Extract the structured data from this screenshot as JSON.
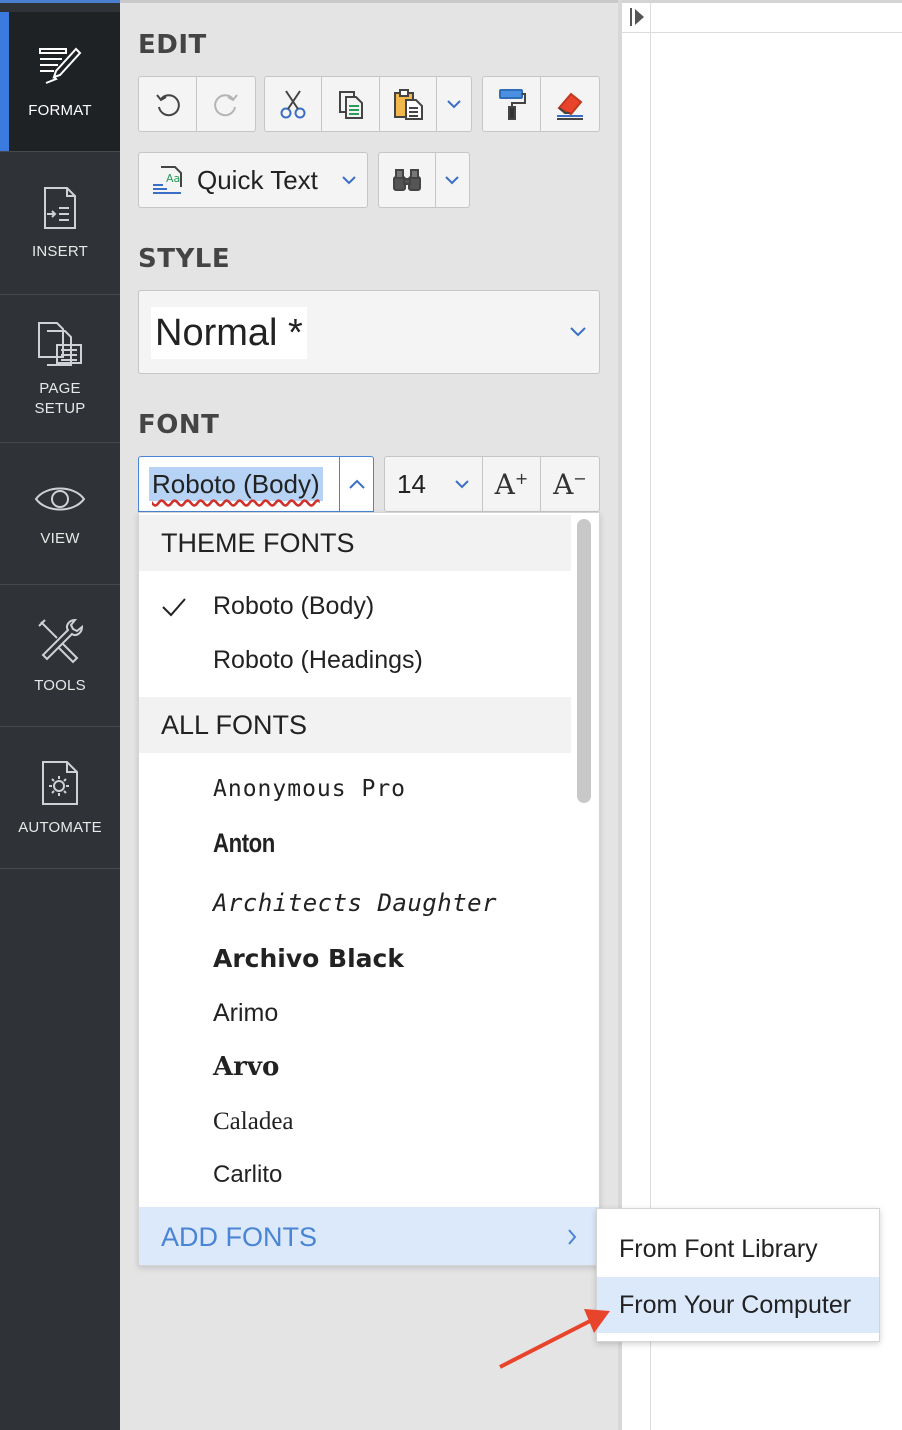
{
  "nav_rail": {
    "items": [
      {
        "label": "FORMAT",
        "icon": "format-brush-icon",
        "active": true
      },
      {
        "label": "INSERT",
        "icon": "insert-icon",
        "active": false
      },
      {
        "label": "PAGE\nSETUP",
        "icon": "page-setup-icon",
        "active": false
      },
      {
        "label": "VIEW",
        "icon": "eye-icon",
        "active": false
      },
      {
        "label": "TOOLS",
        "icon": "tools-icon",
        "active": false
      },
      {
        "label": "AUTOMATE",
        "icon": "automate-icon",
        "active": false
      }
    ]
  },
  "panel": {
    "edit": {
      "title": "EDIT",
      "quick_text_label": "Quick Text"
    },
    "style": {
      "title": "STYLE",
      "value": "Normal *"
    },
    "font": {
      "title": "FONT",
      "current_font": "Roboto (Body)",
      "size": "14"
    }
  },
  "font_dropdown": {
    "theme_header": "THEME FONTS",
    "theme_fonts": [
      {
        "label": "Roboto (Body)",
        "checked": true
      },
      {
        "label": "Roboto (Headings)",
        "checked": false
      }
    ],
    "all_header": "ALL FONTS",
    "all_fonts": [
      "Anonymous Pro",
      "Anton",
      "Architects Daughter",
      "Archivo Black",
      "Arimo",
      "Arvo",
      "Caladea",
      "Carlito"
    ],
    "add_fonts_label": "ADD FONTS"
  },
  "add_fonts_submenu": {
    "items": [
      {
        "label": "From Font Library",
        "highlighted": false
      },
      {
        "label": "From Your Computer",
        "highlighted": true
      }
    ]
  },
  "colors": {
    "rail_bg": "#2f3337",
    "accent_blue": "#3b7be0",
    "highlight": "#dce9fb",
    "annotation_arrow": "#e8442c"
  }
}
